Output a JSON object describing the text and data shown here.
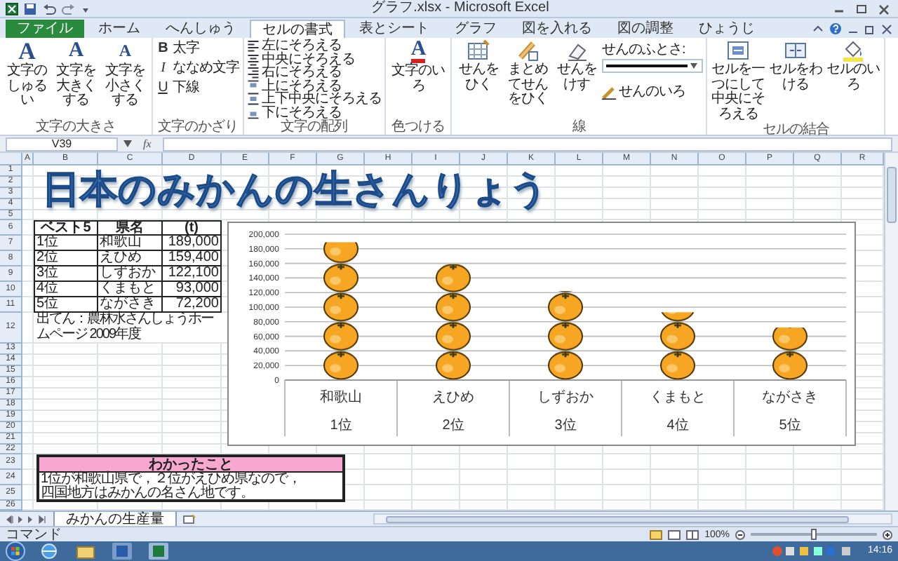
{
  "window": {
    "title": "グラフ.xlsx - Microsoft Excel"
  },
  "ribbon_tabs": [
    {
      "label": "ファイル",
      "kind": "file",
      "selected": false
    },
    {
      "label": "ホーム",
      "kind": "tab",
      "selected": false
    },
    {
      "label": "へんしゅう",
      "kind": "tab",
      "selected": false
    },
    {
      "label": "セルの書式",
      "kind": "tab",
      "selected": true
    },
    {
      "label": "表とシート",
      "kind": "tab",
      "selected": false
    },
    {
      "label": "グラフ",
      "kind": "tab",
      "selected": false
    },
    {
      "label": "図を入れる",
      "kind": "tab",
      "selected": false
    },
    {
      "label": "図の調整",
      "kind": "tab",
      "selected": false
    },
    {
      "label": "ひょうじ",
      "kind": "tab",
      "selected": false
    }
  ],
  "ribbon_groups": [
    {
      "label": "文字の大きさ",
      "items": [
        {
          "kind": "large",
          "glyph": "A",
          "label": "文字のしゅるい"
        },
        {
          "kind": "large",
          "glyph": "A",
          "label": "文字を大きくする"
        },
        {
          "kind": "large",
          "glyph": "A",
          "label": "文字を小さくする"
        }
      ]
    },
    {
      "label": "文字のかざり",
      "items": [
        {
          "kind": "small",
          "glyph": "B",
          "label": "太字"
        },
        {
          "kind": "small",
          "glyph": "I",
          "label": "ななめ文字"
        },
        {
          "kind": "small",
          "glyph": "U",
          "label": "下線"
        }
      ]
    },
    {
      "label": "文字の配列",
      "items": [
        {
          "kind": "small",
          "label": "左にそろえる"
        },
        {
          "kind": "small",
          "label": "中央にそろえる"
        },
        {
          "kind": "small",
          "label": "右にそろえる"
        },
        {
          "kind": "small",
          "label": "上にそろえる"
        },
        {
          "kind": "small",
          "label": "上下中央にそろえる"
        },
        {
          "kind": "small",
          "label": "下にそろえる"
        }
      ]
    },
    {
      "label": "色つける",
      "items": [
        {
          "kind": "large",
          "glyph": "A",
          "label": "文字のいろ"
        }
      ]
    },
    {
      "label": "線",
      "items": [
        {
          "kind": "large",
          "label": "せんをひく"
        },
        {
          "kind": "large",
          "label": "まとめてせんをひく"
        },
        {
          "kind": "large",
          "label": "せんをけす"
        },
        {
          "kind": "line_width",
          "label": "せんのふとさ:"
        },
        {
          "kind": "line_color",
          "label": "せんのいろ"
        }
      ]
    },
    {
      "label": "セルの結合",
      "items": [
        {
          "kind": "large",
          "label": "セルを一つにして中央にそろえる"
        },
        {
          "kind": "large",
          "label": "セルをわける"
        },
        {
          "kind": "large",
          "label": "セルのいろ"
        }
      ]
    }
  ],
  "formula_bar": {
    "name_box": "V39",
    "function_label": "fx"
  },
  "sheet": {
    "columns": [
      "A",
      "B",
      "C",
      "D",
      "E",
      "F",
      "G",
      "H",
      "I",
      "J",
      "K",
      "L",
      "M",
      "N",
      "O",
      "P",
      "Q",
      "R"
    ],
    "rows": [
      "1",
      "2",
      "3",
      "4",
      "5",
      "6",
      "7",
      "8",
      "9",
      "10",
      "11",
      "12",
      "13",
      "14",
      "15",
      "16",
      "17",
      "18",
      "19",
      "20",
      "21",
      "22",
      "23",
      "24",
      "25",
      "26"
    ],
    "title": "日本のみかんの生さんりょう",
    "table": {
      "header": [
        "ベスト5",
        "県名",
        "(t)"
      ],
      "rows": [
        [
          "1位",
          "和歌山",
          "189,000"
        ],
        [
          "2位",
          "えひめ",
          "159,400"
        ],
        [
          "3位",
          "しずおか",
          "122,100"
        ],
        [
          "4位",
          "くまもと",
          "93,000"
        ],
        [
          "5位",
          "ながさき",
          "72,200"
        ]
      ]
    },
    "source_note": "出てん：農林水さんしょうホームページ 2009年度",
    "chart": {
      "rank_labels": [
        "1位",
        "2位",
        "3位",
        "4位",
        "5位"
      ],
      "chart_data": {
        "type": "bar",
        "categories": [
          "和歌山",
          "えひめ",
          "しずおか",
          "くまもと",
          "ながさき"
        ],
        "series": [
          {
            "values": [
              189000,
              159000,
              122000,
              93000,
              72000
            ]
          }
        ],
        "grid": true,
        "ylim": [
          0,
          200000
        ],
        "yticks": [
          {
            "value": 0,
            "label": "0"
          },
          {
            "value": 20000,
            "label": "20,000"
          },
          {
            "value": 40000,
            "label": "40,000"
          },
          {
            "value": 60000,
            "label": "60,000"
          },
          {
            "value": 80000,
            "label": "80,000"
          },
          {
            "value": 100000,
            "label": "100,000"
          },
          {
            "value": 120000,
            "label": "120,000"
          },
          {
            "value": 140000,
            "label": "140,000"
          },
          {
            "value": 160000,
            "label": "160,000"
          },
          {
            "value": 180000,
            "label": "180,000"
          },
          {
            "value": 200000,
            "label": "200,000"
          }
        ]
      }
    },
    "findings": {
      "heading": "わかったこと",
      "lines": [
        "1位が和歌山県で，２位がえひめ県なので，",
        "四国地方はみかんの名さん地です。"
      ]
    }
  },
  "sheet_tabs": [
    {
      "label": "みかんの生産量",
      "selected": true
    }
  ],
  "status_bar": {
    "mode": "コマンド",
    "zoom": "100%",
    "zoom_slider": {
      "level": 0.5
    }
  },
  "taskbar": {
    "clock": "14:16"
  }
}
